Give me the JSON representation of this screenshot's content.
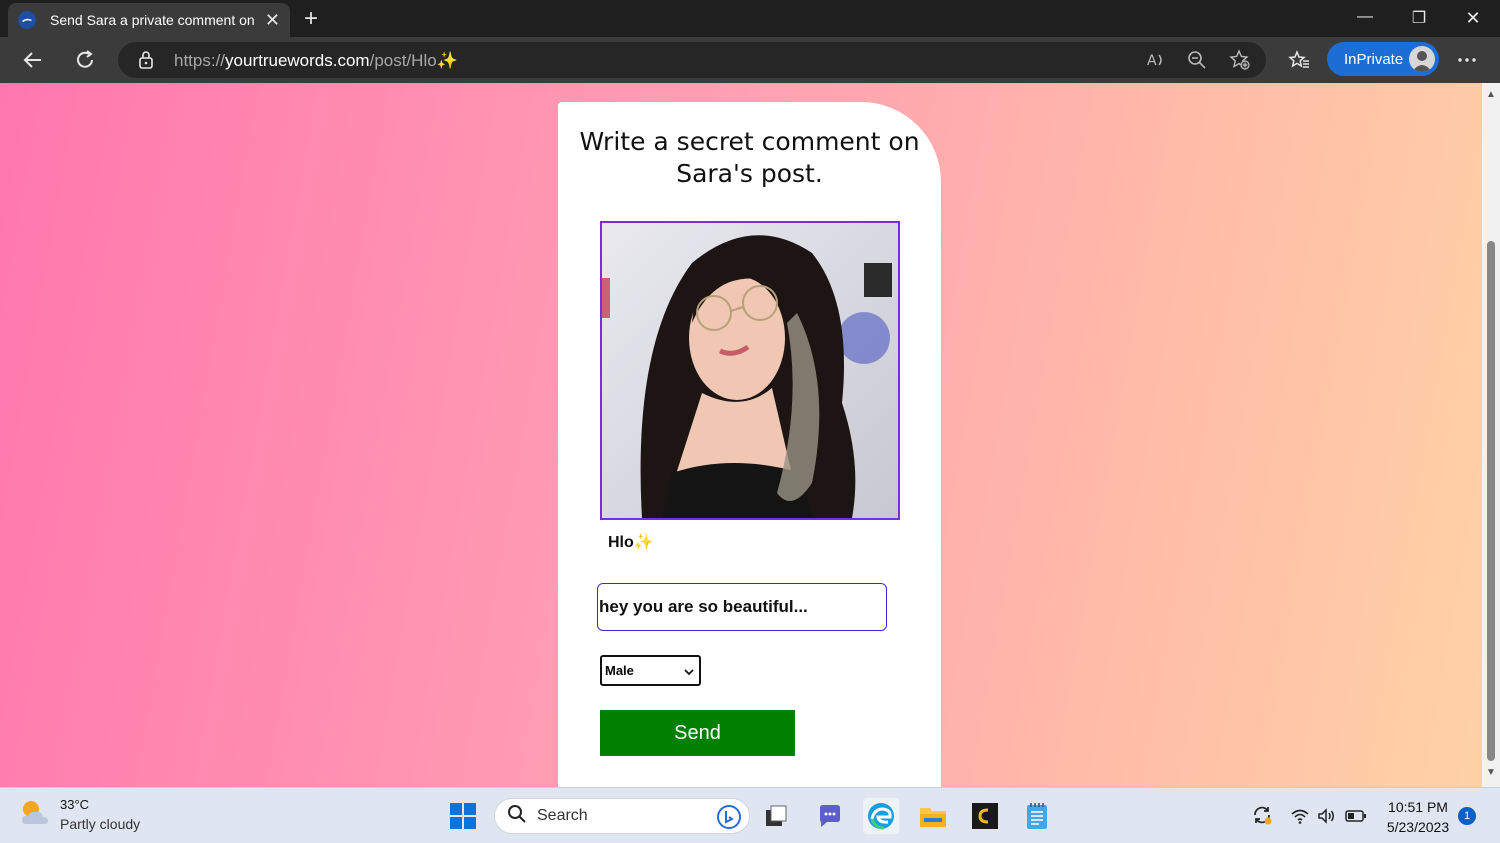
{
  "browser": {
    "tab_title": "Send Sara a private comment on",
    "url_prefix": "https://",
    "url_host": "yourtruewords.com",
    "url_path": "/post/Hlo✨",
    "inprivate_label": "InPrivate"
  },
  "page": {
    "heading": "Write a secret comment on Sara's post.",
    "caption": "Hlo✨",
    "comment_value": "hey you are so beautiful...",
    "gender_selected": "Male",
    "send_label": "Send",
    "accent_color": "#7b2be0",
    "send_color": "#008000"
  },
  "taskbar": {
    "weather_temp": "33°C",
    "weather_desc": "Partly cloudy",
    "search_placeholder": "Search",
    "time": "10:51 PM",
    "date": "5/23/2023",
    "notification_count": "1"
  }
}
